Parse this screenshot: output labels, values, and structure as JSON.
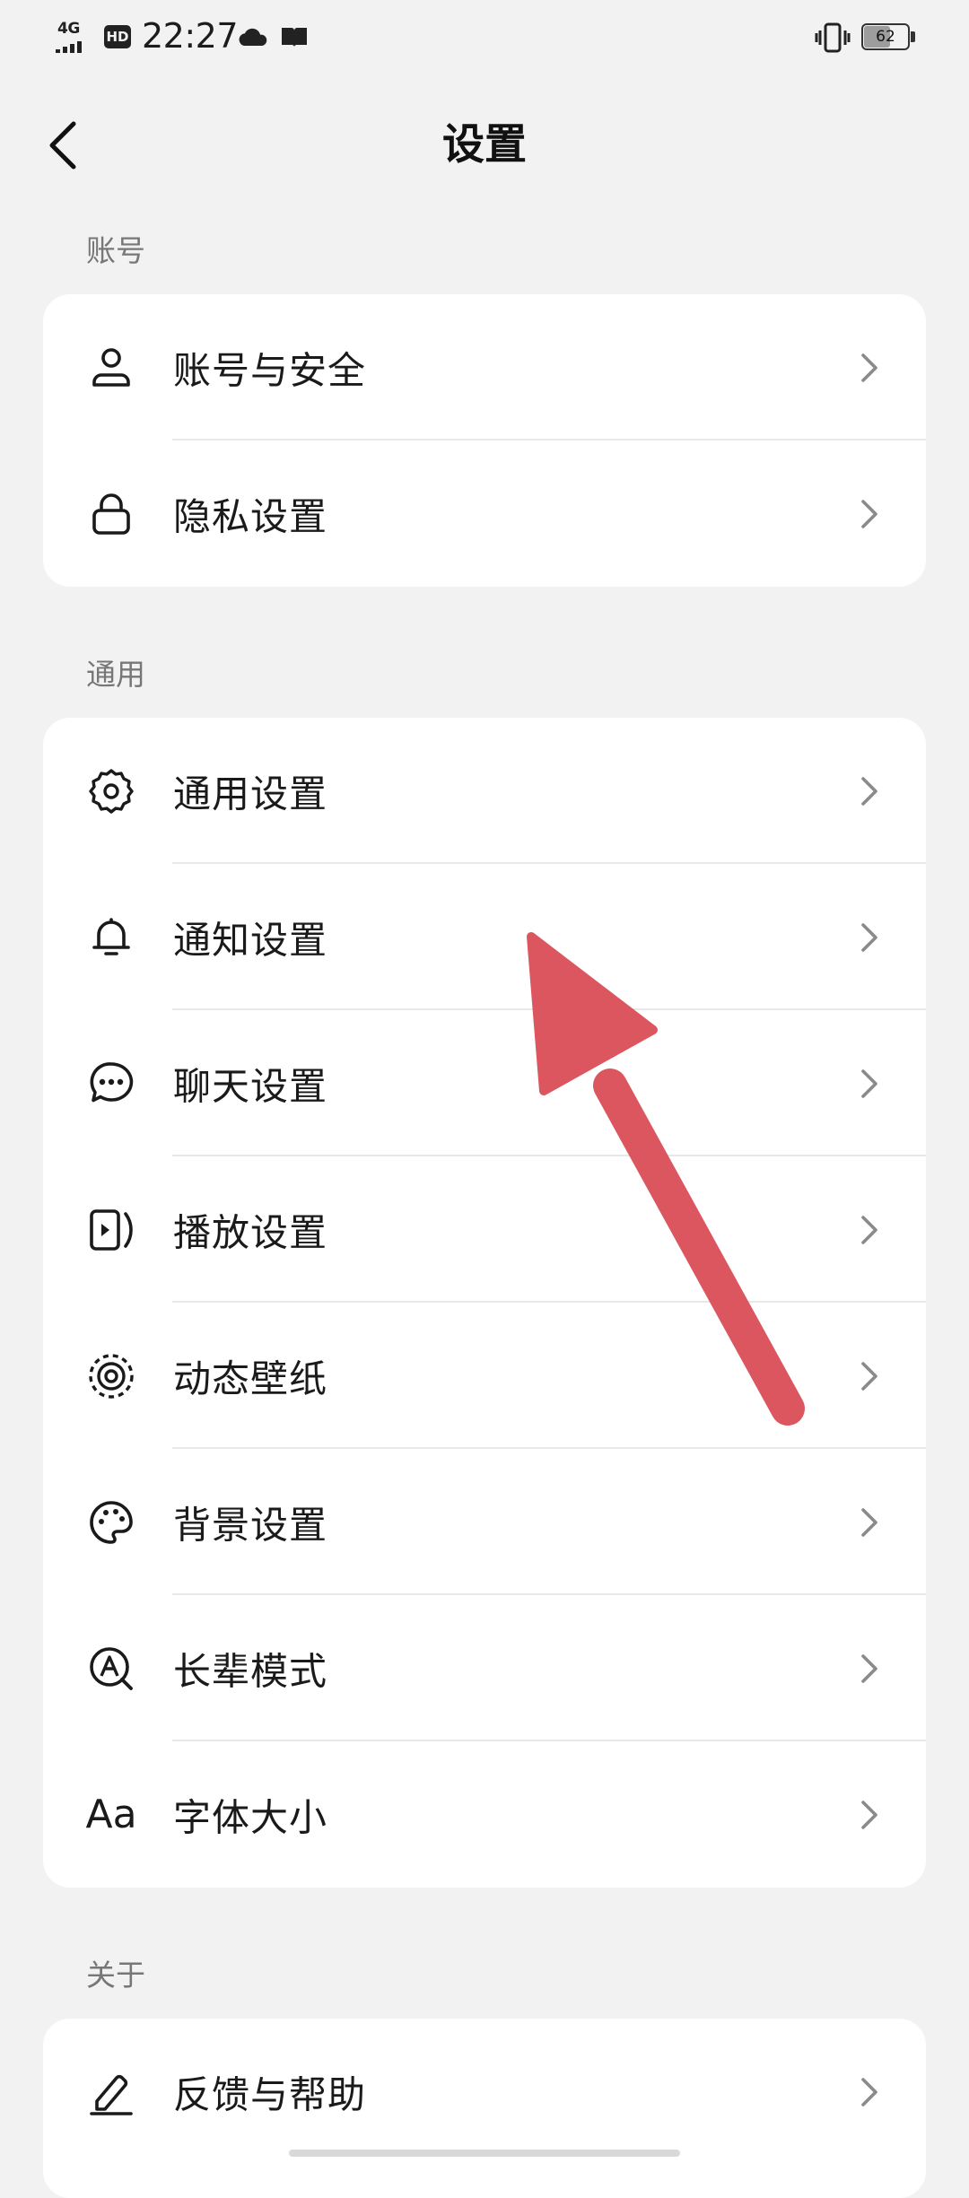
{
  "status_bar": {
    "network": "4G",
    "hd": "HD",
    "time": "22:27",
    "battery": "62"
  },
  "header": {
    "title": "设置",
    "back_icon": "chevron-left-icon"
  },
  "sections": [
    {
      "label": "账号",
      "items": [
        {
          "label": "账号与安全",
          "icon": "user-icon"
        },
        {
          "label": "隐私设置",
          "icon": "lock-icon"
        }
      ]
    },
    {
      "label": "通用",
      "items": [
        {
          "label": "通用设置",
          "icon": "gear-icon"
        },
        {
          "label": "通知设置",
          "icon": "bell-icon"
        },
        {
          "label": "聊天设置",
          "icon": "chat-bubble-icon"
        },
        {
          "label": "播放设置",
          "icon": "play-screen-icon"
        },
        {
          "label": "动态壁纸",
          "icon": "live-wallpaper-icon"
        },
        {
          "label": "背景设置",
          "icon": "palette-icon"
        },
        {
          "label": "长辈模式",
          "icon": "elder-mode-icon"
        },
        {
          "label": "字体大小",
          "icon": "font-size-icon",
          "icon_text": "Aa"
        }
      ]
    },
    {
      "label": "关于",
      "items": [
        {
          "label": "反馈与帮助",
          "icon": "edit-icon"
        }
      ]
    }
  ],
  "colors": {
    "background": "#f2f2f2",
    "card": "#ffffff",
    "annotation_arrow": "#dc5660"
  }
}
